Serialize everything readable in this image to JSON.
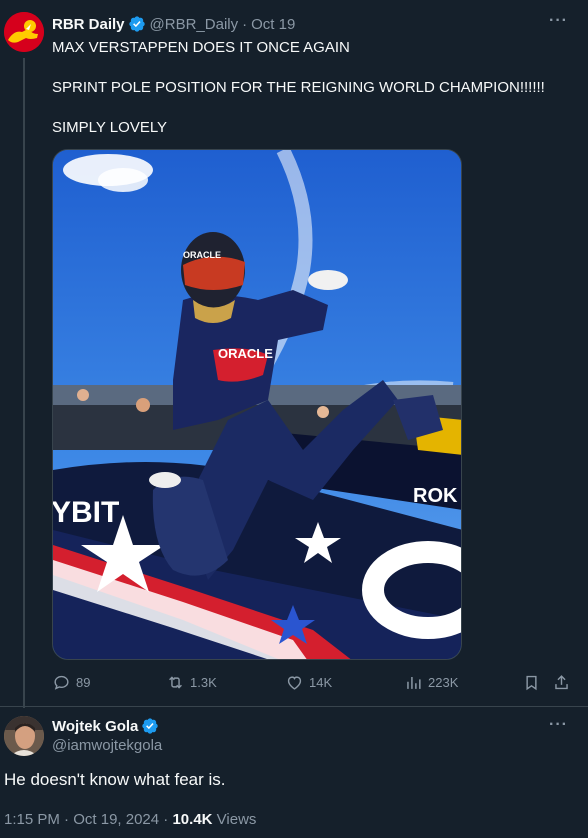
{
  "parent": {
    "author_name": "RBR Daily",
    "author_handle": "@RBR_Daily",
    "separator": "·",
    "date": "Oct 19",
    "more": "···",
    "lines": [
      "MAX VERSTAPPEN DOES IT ONCE AGAIN",
      "SPRINT POLE POSITION FOR THE REIGNING WORLD CHAMPION!!!!!!",
      "SIMPLY LOVELY"
    ],
    "photo_texts": {
      "oracle": "ORACLE",
      "bybit": "YBIT",
      "rok": "ROK"
    },
    "actions": {
      "replies": "89",
      "reposts": "1.3K",
      "likes": "14K",
      "views": "223K"
    },
    "icons": [
      "reply-icon",
      "repost-icon",
      "like-icon",
      "views-icon",
      "bookmark-icon",
      "share-icon",
      "verified-badge-icon"
    ]
  },
  "reply": {
    "author_name": "Wojtek Gola",
    "author_handle": "@iamwojtekgola",
    "more": "···",
    "text": "He doesn't know what fear is.",
    "time": "1:15 PM",
    "separator": "·",
    "date": "Oct 19, 2024",
    "views_count": "10.4K",
    "views_label": "Views"
  },
  "colors": {
    "background": "#15202b",
    "text": "#f7f9f9",
    "muted": "#8b98a5",
    "verified": "#1d9bf0",
    "border": "#38444d"
  }
}
